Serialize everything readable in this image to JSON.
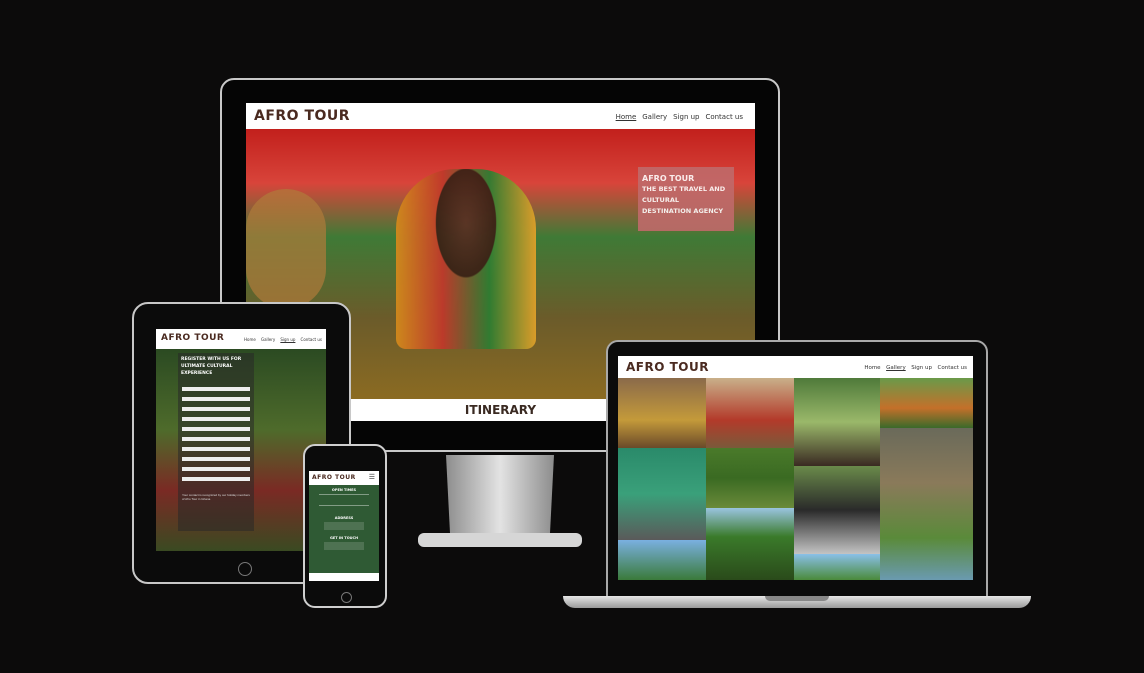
{
  "brand": "AFRO TOUR",
  "nav": {
    "home": "Home",
    "gallery": "Gallery",
    "signup": "Sign up",
    "contact": "Contact us"
  },
  "monitor": {
    "hero_title": "AFRO TOUR",
    "hero_subtitle": "THE BEST TRAVEL AND CULTURAL DESTINATION AGENCY",
    "section_heading": "ITINERARY"
  },
  "tablet": {
    "form_heading": "REGISTER WITH US FOR ULTIMATE CULTURAL EXPERIENCE",
    "consent_text": "Your contact is recognized by our holiday members of Afro Tour in Ghana"
  },
  "phone": {
    "open_times": "OPEN TIMES",
    "address_heading": "ADDRESS",
    "get_in_touch": "GET IN TOUCH",
    "menu_icon": "hamburger-icon"
  },
  "colors": {
    "brand_text": "#4a2a20",
    "hero_box": "#c06a6a",
    "phone_green": "#2f5a34"
  }
}
